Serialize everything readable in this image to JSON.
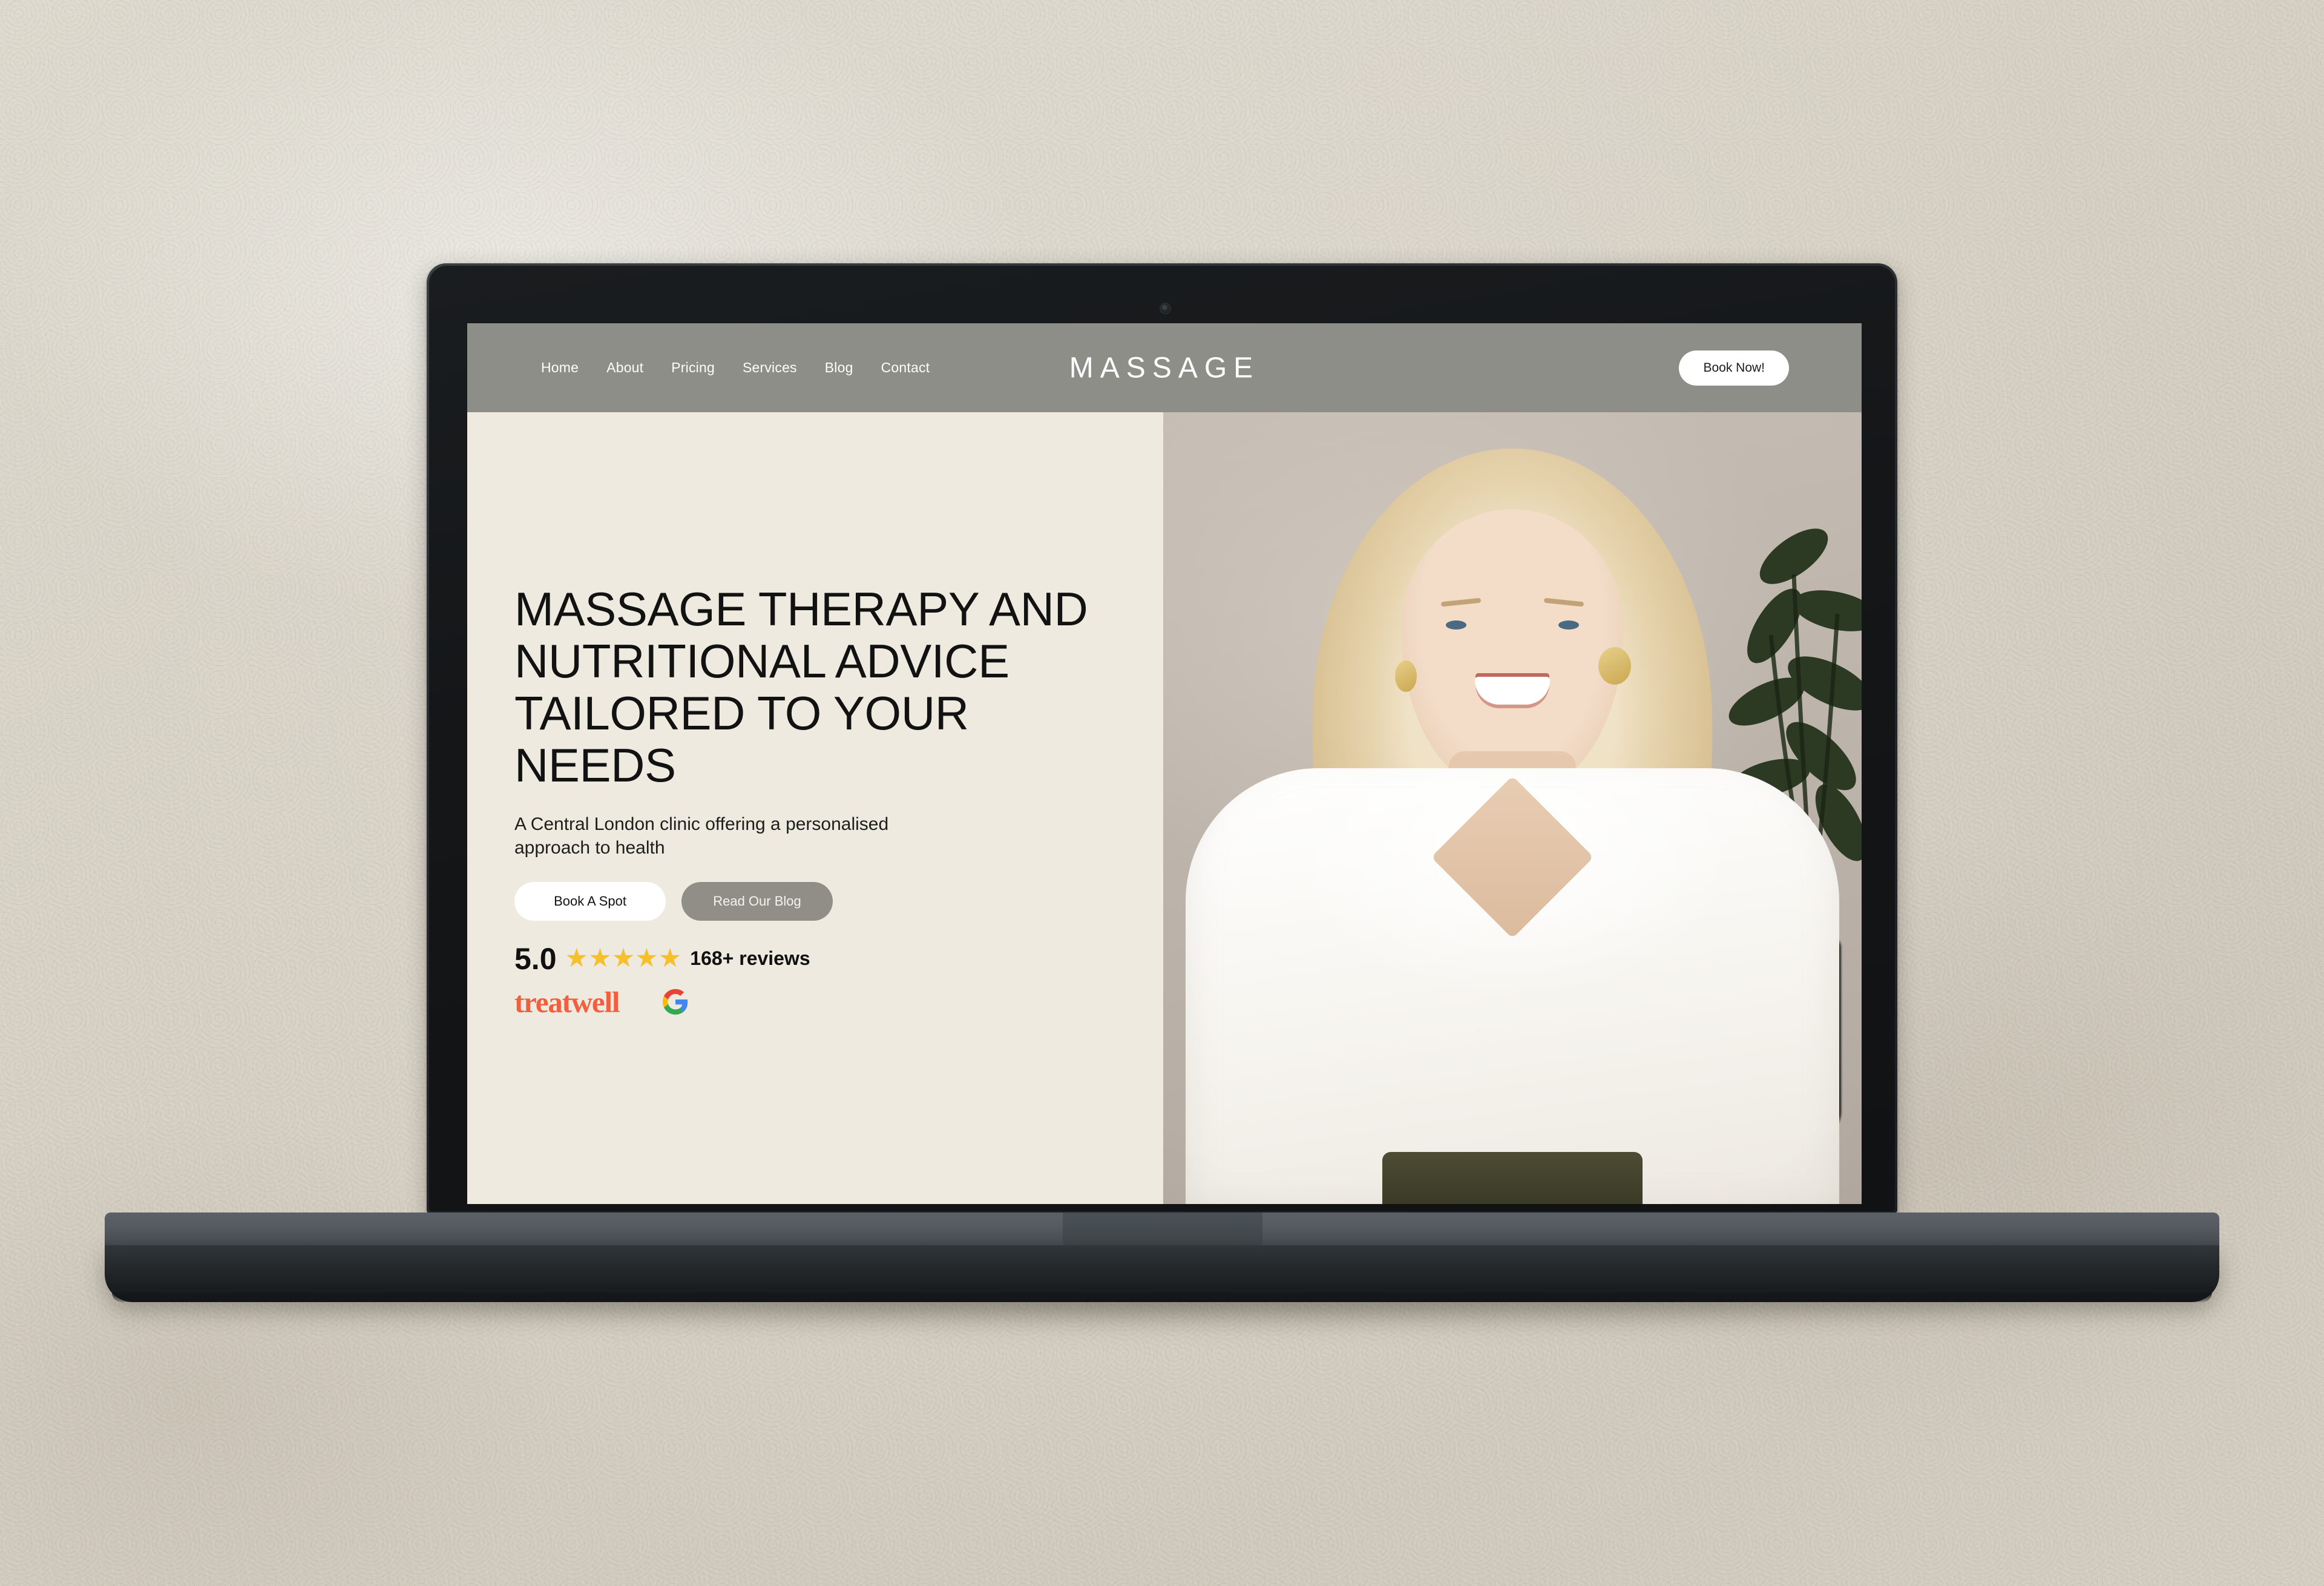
{
  "site": {
    "nav": {
      "links": [
        {
          "label": "Home"
        },
        {
          "label": "About"
        },
        {
          "label": "Pricing"
        },
        {
          "label": "Services"
        },
        {
          "label": "Blog"
        },
        {
          "label": "Contact"
        }
      ],
      "brand": "MASSAGE",
      "cta_label": "Book Now!",
      "bar_color": "#8e8e88"
    },
    "hero": {
      "headline": "MASSAGE THERAPY AND NUTRITIONAL ADVICE TAILORED TO YOUR NEEDS",
      "subheadline": "A Central London clinic offering a personalised approach to health",
      "primary_button": "Book A Spot",
      "secondary_button": "Read Our Blog",
      "panel_color": "#EFEAE0",
      "rating": {
        "score": "5.0",
        "stars": "★★★★★",
        "star_count": 5,
        "star_color": "#F5C02B",
        "count_label": "168+ reviews"
      },
      "badges": {
        "treatwell_label": "treatwell",
        "treatwell_color": "#F25F3E",
        "google_icon": "google-g-icon"
      },
      "image_alt": "Smiling blonde woman in a white blouse seated in a clinic with a potted plant behind her"
    }
  },
  "device": {
    "type": "laptop-mockup",
    "body_color": "#2d3236",
    "camera_icon": "webcam-dot-icon"
  },
  "background": {
    "surface": "textured plaster wall",
    "color": "#d9d4c9"
  }
}
